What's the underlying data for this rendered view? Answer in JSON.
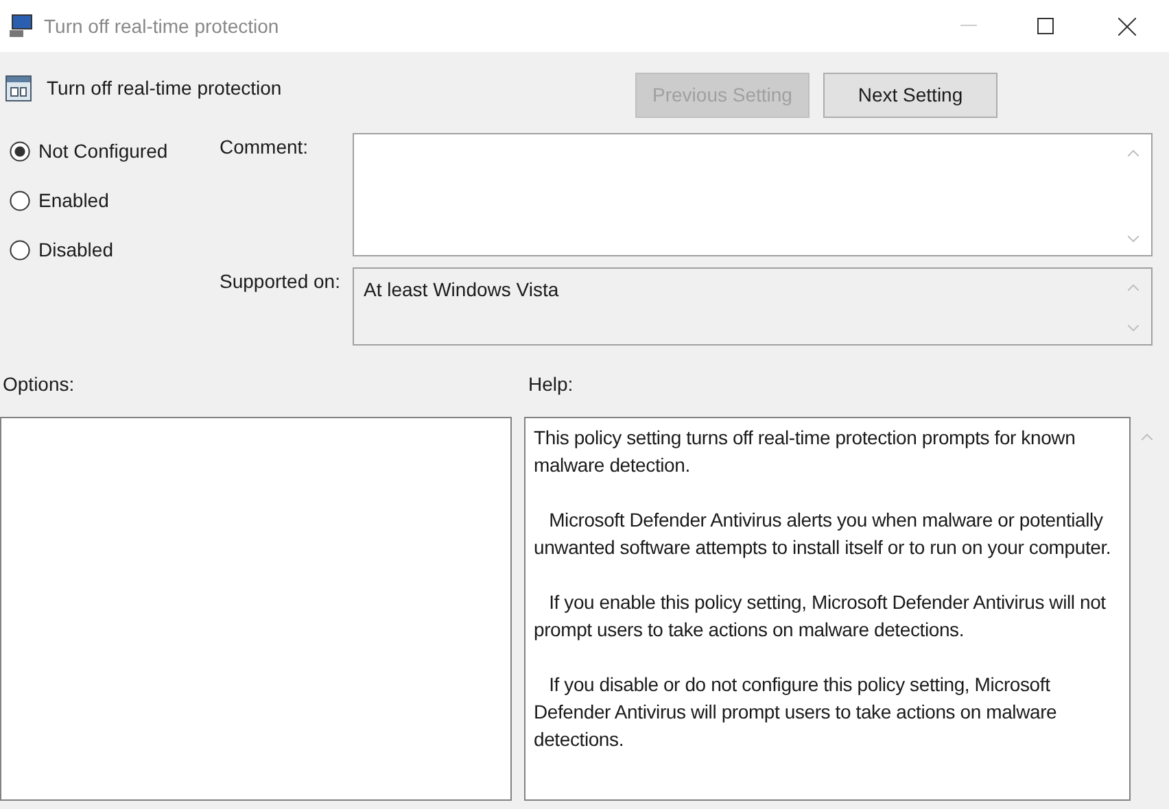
{
  "window": {
    "title": "Turn off real-time protection"
  },
  "header": {
    "title": "Turn off real-time protection"
  },
  "buttons": [
    {
      "label": "Previous Setting",
      "disabled": true
    },
    {
      "label": "Next Setting",
      "disabled": false
    }
  ],
  "options_radio": [
    {
      "label": "Not Configured",
      "selected": true
    },
    {
      "label": "Enabled",
      "selected": false
    },
    {
      "label": "Disabled",
      "selected": false
    }
  ],
  "comment": {
    "label": "Comment:"
  },
  "supported_on": {
    "label": "Supported on:",
    "value": "At least Windows Vista"
  },
  "options": {
    "label": "Options:"
  },
  "help": {
    "label": "Help:",
    "paragraphs": [
      "This policy setting turns off real-time protection prompts for known malware detection.",
      "   Microsoft Defender Antivirus alerts you when malware or potentially unwanted software attempts to install itself or to run on your computer.",
      "   If you enable this policy setting, Microsoft Defender Antivirus will not prompt users to take actions on malware detections.",
      "   If you disable or do not configure this policy setting, Microsoft Defender Antivirus will prompt users to take actions on malware detections."
    ]
  }
}
